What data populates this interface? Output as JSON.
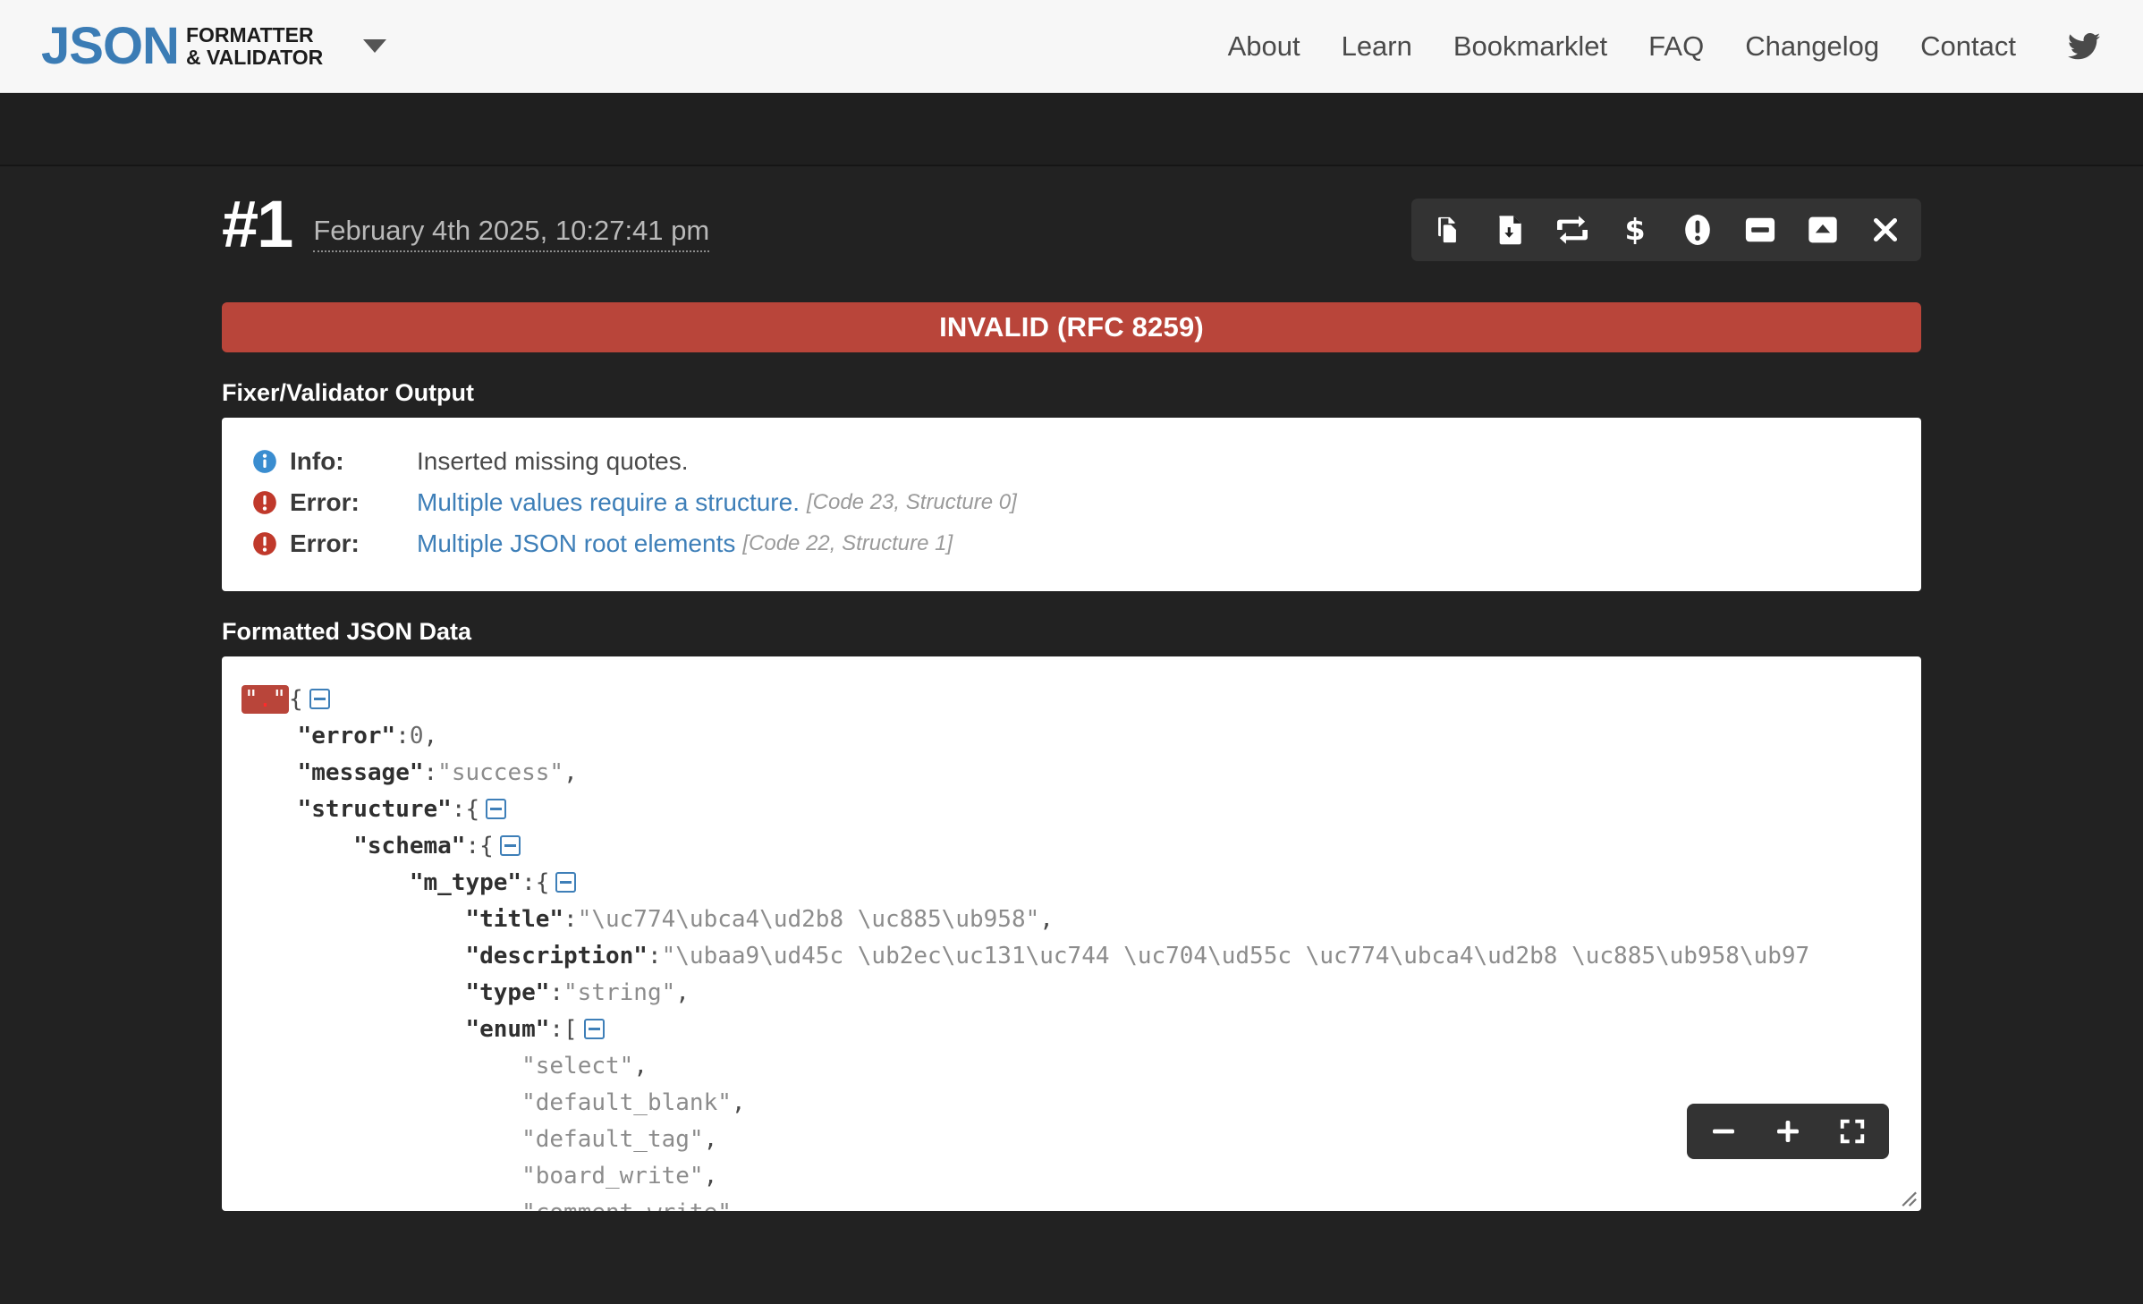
{
  "header": {
    "logo_main": "JSON",
    "logo_line1": "FORMATTER",
    "logo_line2": "& VALIDATOR",
    "nav": [
      {
        "label": "About"
      },
      {
        "label": "Learn"
      },
      {
        "label": "Bookmarklet"
      },
      {
        "label": "FAQ"
      },
      {
        "label": "Changelog"
      },
      {
        "label": "Contact"
      }
    ],
    "twitter_icon": "twitter-icon",
    "dropdown_icon": "chevron-down-icon"
  },
  "result": {
    "number": "#1",
    "timestamp": "February 4th 2025, 10:27:41 pm",
    "status_text": "INVALID (RFC 8259)",
    "status_color": "#b9453a",
    "toolbar": [
      {
        "name": "copy-icon",
        "title": "Copy to clipboard"
      },
      {
        "name": "download-file-icon",
        "title": "Download"
      },
      {
        "name": "refresh-icon",
        "title": "Revalidate"
      },
      {
        "name": "dollar-icon",
        "title": "Donate"
      },
      {
        "name": "exclamation-circle-icon",
        "title": "Errors"
      },
      {
        "name": "minus-square-icon",
        "title": "Collapse"
      },
      {
        "name": "caret-up-square-icon",
        "title": "Scroll to top"
      },
      {
        "name": "close-icon",
        "title": "Close"
      }
    ]
  },
  "validator": {
    "section_title": "Fixer/Validator Output",
    "rows": [
      {
        "icon": "info-circle-icon",
        "icon_color": "#3a8dd0",
        "label": "Info:",
        "message": "Inserted missing quotes.",
        "is_link": false,
        "code": ""
      },
      {
        "icon": "error-circle-icon",
        "icon_color": "#c0392b",
        "label": "Error:",
        "message": "Multiple values require a structure.",
        "is_link": true,
        "code": "[Code 23, Structure 0]"
      },
      {
        "icon": "error-circle-icon",
        "icon_color": "#c0392b",
        "label": "Error:",
        "message": "Multiple JSON root elements",
        "is_link": true,
        "code": "[Code 22, Structure 1]"
      }
    ]
  },
  "formatted": {
    "section_title": "Formatted JSON Data",
    "error_token": "\"",
    "error_dot": ".",
    "error_token_end": "\"",
    "open_brace": "{",
    "lines": [
      {
        "indent": 1,
        "key": "\"error\"",
        "sep": ":",
        "value": "0",
        "tail": ",",
        "toggle": false,
        "vclass": "n"
      },
      {
        "indent": 1,
        "key": "\"message\"",
        "sep": ":",
        "value": "\"success\"",
        "tail": ",",
        "toggle": false,
        "vclass": "v"
      },
      {
        "indent": 1,
        "key": "\"structure\"",
        "sep": ":",
        "value": "{",
        "tail": "",
        "toggle": true,
        "vclass": "p"
      },
      {
        "indent": 2,
        "key": "\"schema\"",
        "sep": ":",
        "value": "{",
        "tail": "",
        "toggle": true,
        "vclass": "p"
      },
      {
        "indent": 3,
        "key": "\"m_type\"",
        "sep": ":",
        "value": "{",
        "tail": "",
        "toggle": true,
        "vclass": "p"
      },
      {
        "indent": 4,
        "key": "\"title\"",
        "sep": ":",
        "value": "\"\\uc774\\ubca4\\ud2b8 \\uc885\\ub958\"",
        "tail": ",",
        "toggle": false,
        "vclass": "v"
      },
      {
        "indent": 4,
        "key": "\"description\"",
        "sep": ":",
        "value": "\"\\ubaa9\\ud45c \\ub2ec\\uc131\\uc744 \\uc704\\ud55c \\uc774\\ubca4\\ud2b8 \\uc885\\ub958\\ub97",
        "tail": "",
        "toggle": false,
        "vclass": "v"
      },
      {
        "indent": 4,
        "key": "\"type\"",
        "sep": ":",
        "value": "\"string\"",
        "tail": ",",
        "toggle": false,
        "vclass": "v"
      },
      {
        "indent": 4,
        "key": "\"enum\"",
        "sep": ":",
        "value": "[",
        "tail": "",
        "toggle": true,
        "vclass": "p"
      },
      {
        "indent": 5,
        "key": "",
        "sep": "",
        "value": "\"select\"",
        "tail": ",",
        "toggle": false,
        "vclass": "v"
      },
      {
        "indent": 5,
        "key": "",
        "sep": "",
        "value": "\"default_blank\"",
        "tail": ",",
        "toggle": false,
        "vclass": "v"
      },
      {
        "indent": 5,
        "key": "",
        "sep": "",
        "value": "\"default_tag\"",
        "tail": ",",
        "toggle": false,
        "vclass": "v"
      },
      {
        "indent": 5,
        "key": "",
        "sep": "",
        "value": "\"board_write\"",
        "tail": ",",
        "toggle": false,
        "vclass": "v"
      },
      {
        "indent": 5,
        "key": "",
        "sep": "",
        "value": "\"comment_write\"",
        "tail": ",",
        "toggle": false,
        "vclass": "v"
      }
    ],
    "zoom_controls": [
      {
        "name": "zoom-out-icon",
        "label": "−"
      },
      {
        "name": "zoom-in-icon",
        "label": "+"
      },
      {
        "name": "fullscreen-icon",
        "label": ""
      }
    ]
  }
}
